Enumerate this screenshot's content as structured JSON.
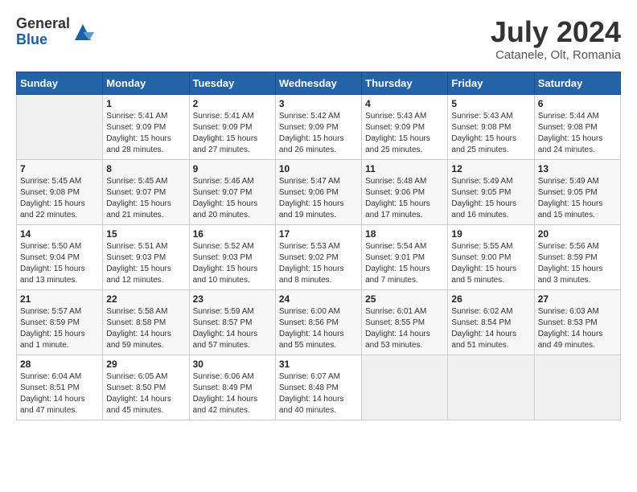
{
  "header": {
    "logo_general": "General",
    "logo_blue": "Blue",
    "month_title": "July 2024",
    "location": "Catanele, Olt, Romania"
  },
  "weekdays": [
    "Sunday",
    "Monday",
    "Tuesday",
    "Wednesday",
    "Thursday",
    "Friday",
    "Saturday"
  ],
  "weeks": [
    [
      {
        "day": "",
        "info": ""
      },
      {
        "day": "1",
        "info": "Sunrise: 5:41 AM\nSunset: 9:09 PM\nDaylight: 15 hours\nand 28 minutes."
      },
      {
        "day": "2",
        "info": "Sunrise: 5:41 AM\nSunset: 9:09 PM\nDaylight: 15 hours\nand 27 minutes."
      },
      {
        "day": "3",
        "info": "Sunrise: 5:42 AM\nSunset: 9:09 PM\nDaylight: 15 hours\nand 26 minutes."
      },
      {
        "day": "4",
        "info": "Sunrise: 5:43 AM\nSunset: 9:09 PM\nDaylight: 15 hours\nand 25 minutes."
      },
      {
        "day": "5",
        "info": "Sunrise: 5:43 AM\nSunset: 9:08 PM\nDaylight: 15 hours\nand 25 minutes."
      },
      {
        "day": "6",
        "info": "Sunrise: 5:44 AM\nSunset: 9:08 PM\nDaylight: 15 hours\nand 24 minutes."
      }
    ],
    [
      {
        "day": "7",
        "info": "Sunrise: 5:45 AM\nSunset: 9:08 PM\nDaylight: 15 hours\nand 22 minutes."
      },
      {
        "day": "8",
        "info": "Sunrise: 5:45 AM\nSunset: 9:07 PM\nDaylight: 15 hours\nand 21 minutes."
      },
      {
        "day": "9",
        "info": "Sunrise: 5:46 AM\nSunset: 9:07 PM\nDaylight: 15 hours\nand 20 minutes."
      },
      {
        "day": "10",
        "info": "Sunrise: 5:47 AM\nSunset: 9:06 PM\nDaylight: 15 hours\nand 19 minutes."
      },
      {
        "day": "11",
        "info": "Sunrise: 5:48 AM\nSunset: 9:06 PM\nDaylight: 15 hours\nand 17 minutes."
      },
      {
        "day": "12",
        "info": "Sunrise: 5:49 AM\nSunset: 9:05 PM\nDaylight: 15 hours\nand 16 minutes."
      },
      {
        "day": "13",
        "info": "Sunrise: 5:49 AM\nSunset: 9:05 PM\nDaylight: 15 hours\nand 15 minutes."
      }
    ],
    [
      {
        "day": "14",
        "info": "Sunrise: 5:50 AM\nSunset: 9:04 PM\nDaylight: 15 hours\nand 13 minutes."
      },
      {
        "day": "15",
        "info": "Sunrise: 5:51 AM\nSunset: 9:03 PM\nDaylight: 15 hours\nand 12 minutes."
      },
      {
        "day": "16",
        "info": "Sunrise: 5:52 AM\nSunset: 9:03 PM\nDaylight: 15 hours\nand 10 minutes."
      },
      {
        "day": "17",
        "info": "Sunrise: 5:53 AM\nSunset: 9:02 PM\nDaylight: 15 hours\nand 8 minutes."
      },
      {
        "day": "18",
        "info": "Sunrise: 5:54 AM\nSunset: 9:01 PM\nDaylight: 15 hours\nand 7 minutes."
      },
      {
        "day": "19",
        "info": "Sunrise: 5:55 AM\nSunset: 9:00 PM\nDaylight: 15 hours\nand 5 minutes."
      },
      {
        "day": "20",
        "info": "Sunrise: 5:56 AM\nSunset: 8:59 PM\nDaylight: 15 hours\nand 3 minutes."
      }
    ],
    [
      {
        "day": "21",
        "info": "Sunrise: 5:57 AM\nSunset: 8:59 PM\nDaylight: 15 hours\nand 1 minute."
      },
      {
        "day": "22",
        "info": "Sunrise: 5:58 AM\nSunset: 8:58 PM\nDaylight: 14 hours\nand 59 minutes."
      },
      {
        "day": "23",
        "info": "Sunrise: 5:59 AM\nSunset: 8:57 PM\nDaylight: 14 hours\nand 57 minutes."
      },
      {
        "day": "24",
        "info": "Sunrise: 6:00 AM\nSunset: 8:56 PM\nDaylight: 14 hours\nand 55 minutes."
      },
      {
        "day": "25",
        "info": "Sunrise: 6:01 AM\nSunset: 8:55 PM\nDaylight: 14 hours\nand 53 minutes."
      },
      {
        "day": "26",
        "info": "Sunrise: 6:02 AM\nSunset: 8:54 PM\nDaylight: 14 hours\nand 51 minutes."
      },
      {
        "day": "27",
        "info": "Sunrise: 6:03 AM\nSunset: 8:53 PM\nDaylight: 14 hours\nand 49 minutes."
      }
    ],
    [
      {
        "day": "28",
        "info": "Sunrise: 6:04 AM\nSunset: 8:51 PM\nDaylight: 14 hours\nand 47 minutes."
      },
      {
        "day": "29",
        "info": "Sunrise: 6:05 AM\nSunset: 8:50 PM\nDaylight: 14 hours\nand 45 minutes."
      },
      {
        "day": "30",
        "info": "Sunrise: 6:06 AM\nSunset: 8:49 PM\nDaylight: 14 hours\nand 42 minutes."
      },
      {
        "day": "31",
        "info": "Sunrise: 6:07 AM\nSunset: 8:48 PM\nDaylight: 14 hours\nand 40 minutes."
      },
      {
        "day": "",
        "info": ""
      },
      {
        "day": "",
        "info": ""
      },
      {
        "day": "",
        "info": ""
      }
    ]
  ]
}
